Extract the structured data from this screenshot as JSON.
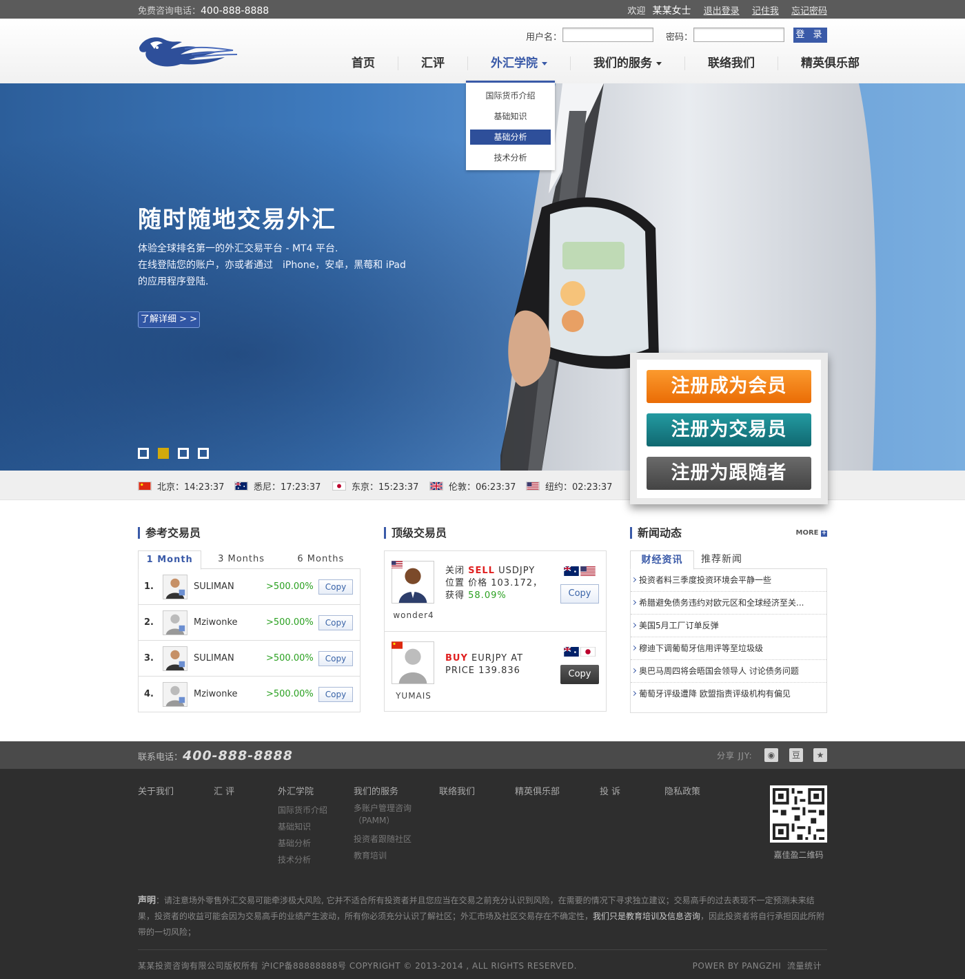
{
  "topbar": {
    "hotline_label": "免费咨询电话：",
    "hotline": "400-888-8888",
    "welcome": "欢迎",
    "user": "某某女士",
    "logout": "退出登录",
    "remember": "记住我",
    "forgot": "忘记密码"
  },
  "login": {
    "username_label": "用户名：",
    "password_label": "密码：",
    "submit": "登 录"
  },
  "nav": {
    "items": [
      {
        "label": "首页"
      },
      {
        "label": "汇评"
      },
      {
        "label": "外汇学院"
      },
      {
        "label": "我们的服务"
      },
      {
        "label": "联络我们"
      },
      {
        "label": "精英俱乐部"
      }
    ],
    "accent": "#3a5aa8"
  },
  "dropdown": {
    "items": [
      "国际货币介绍",
      "基础知识",
      "基础分析",
      "技术分析"
    ],
    "selected": "基础分析"
  },
  "hero": {
    "title": "随时随地交易外汇",
    "desc_line1": "体验全球排名第一的外汇交易平台 - MT4 平台.",
    "desc_line2": "在线登陆您的账户，亦或者通过　iPhone，安卓，黑莓和 iPad",
    "desc_line3": "的应用程序登陆.",
    "more": "了解详细 > >",
    "slides": 4,
    "active_slide": 2
  },
  "clocks": [
    {
      "city": "北京：14:23:37",
      "flag": "cn"
    },
    {
      "city": "悉尼：17:23:37",
      "flag": "au"
    },
    {
      "city": "东京：15:23:37",
      "flag": "jp"
    },
    {
      "city": "伦敦：06:23:37",
      "flag": "uk"
    },
    {
      "city": "纽约：02:23:37",
      "flag": "us"
    }
  ],
  "register": {
    "member": "注册成为会员",
    "trader": "注册为交易员",
    "follower": "注册为跟随者",
    "colors": {
      "orange": "#f07d12",
      "teal": "#1a7e84",
      "gray": "#555555"
    }
  },
  "reference": {
    "title": "参考交易员",
    "tabs": [
      "1 Month",
      "3 Months",
      "6 Months"
    ],
    "rows": [
      {
        "num": "1.",
        "name": "SULIMAN",
        "gain": ">500.00%",
        "btn": "Copy"
      },
      {
        "num": "2.",
        "name": "Mziwonke",
        "gain": ">500.00%",
        "btn": "Copy"
      },
      {
        "num": "3.",
        "name": "SULIMAN",
        "gain": ">500.00%",
        "btn": "Copy"
      },
      {
        "num": "4.",
        "name": "Mziwonke",
        "gain": ">500.00%",
        "btn": "Copy"
      }
    ]
  },
  "top": {
    "title": "顶级交易员",
    "t1": {
      "name": "wonder4",
      "action_pre": "关闭 ",
      "action": "SELL",
      "pair": " USDJPY",
      "line2": "位置 价格 103.172，",
      "gain_label": "获得 ",
      "gain": "58.09%",
      "btn": "Copy"
    },
    "t2": {
      "name": "YUMAIS",
      "action": "BUY",
      "pair": " EURJPY AT",
      "line2": "PRICE 139.836",
      "btn": "Copy"
    }
  },
  "news": {
    "title": "新闻动态",
    "more": "MORE",
    "tabs": [
      "财经资讯",
      "推荐新闻"
    ],
    "items": [
      "投资者料三季度投资环境会平静一些",
      "希腊避免债务违约对欧元区和全球经济至关...",
      "美国5月工厂订单反弹",
      "穆迪下调葡萄牙信用评等至垃圾级",
      "奥巴马周四将会晤国会领导人 讨论债务问题",
      "葡萄牙评级遭降 欧盟指责评级机构有偏见"
    ]
  },
  "footer": {
    "phone_label": "联系电话：",
    "phone": "400-888-8888",
    "share": "分享 JJY:",
    "cols": [
      {
        "h": "关于我们",
        "items": []
      },
      {
        "h": "汇 评",
        "items": []
      },
      {
        "h": "外汇学院",
        "items": [
          "国际货币介绍",
          "基础知识",
          "基础分析",
          "技术分析"
        ]
      },
      {
        "h": "我们的服务",
        "items": [
          "多账户管理咨询",
          "（PAMM）",
          "投资者跟随社区",
          "教育培训"
        ]
      },
      {
        "h": "联络我们",
        "items": []
      },
      {
        "h": "精英俱乐部",
        "items": []
      },
      {
        "h": "投 诉",
        "items": []
      },
      {
        "h": "隐私政策",
        "items": []
      }
    ],
    "qr": "嘉佳盈二维码",
    "disclaimer_label": "声明",
    "disclaimer_1": "：请注意场外零售外汇交易可能牵涉极大风险, 它并不适合所有投资者并且您应当在交易之前充分认识到风险，在需要的情况下寻求独立建议；交易高手的过去表现不一定预测未来结果，投资者的收益可能会因为交易高手的业绩产生波动，所有你必须充分认识了解社区；外汇市场及社区交易存在不确定性，",
    "disclaimer_bold": "我们只是教育培训及信息咨询",
    "disclaimer_2": "，因此投资者将自行承担因此所附带的一切风险；",
    "copyright": "某某投资咨询有限公司版权所有 沪ICP备88888888号 COPYRIGHT © 2013-2014 , ALL RIGHTS RESERVED.",
    "power": "POWER BY PANGZHI",
    "stats": "流量统计"
  }
}
